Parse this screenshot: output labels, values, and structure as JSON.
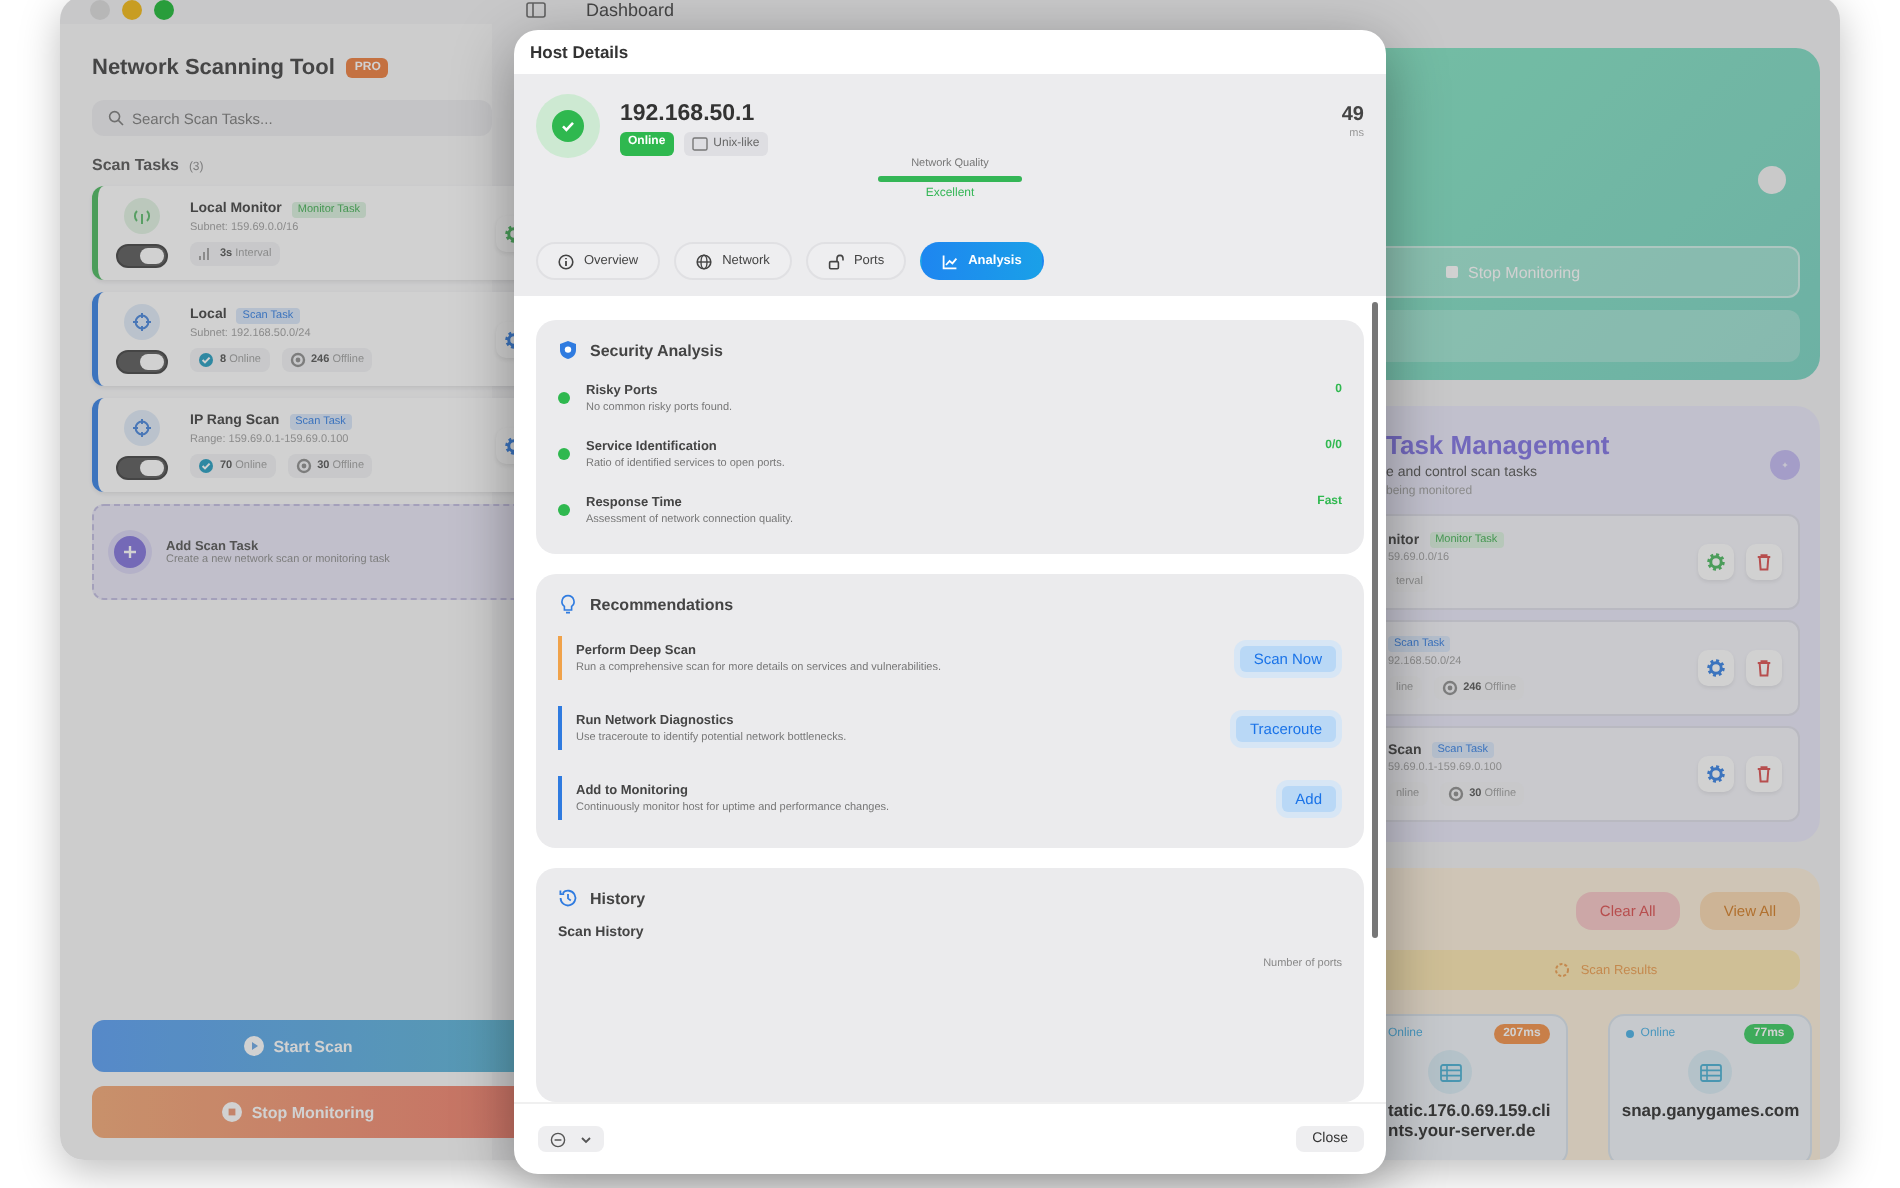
{
  "window": {
    "title": "Dashboard"
  },
  "sidebar": {
    "app_name": "Network Scanning Tool",
    "badge": "PRO",
    "search": {
      "placeholder": "Search Scan Tasks..."
    },
    "section_title": "Scan Tasks",
    "count": "(3)",
    "tasks": [
      {
        "kind": "monitor",
        "name": "Local Monitor",
        "tag": "Monitor Task",
        "detail": "Subnet: 159.69.0.0/16",
        "on": true,
        "stats": [
          {
            "kind": "interval",
            "value": "3s",
            "label": "Interval"
          }
        ]
      },
      {
        "kind": "scan",
        "name": "Local",
        "tag": "Scan Task",
        "detail": "Subnet: 192.168.50.0/24",
        "on": true,
        "stats": [
          {
            "kind": "online",
            "value": "8",
            "label": "Online"
          },
          {
            "kind": "offline",
            "value": "246",
            "label": "Offline"
          }
        ]
      },
      {
        "kind": "scan",
        "name": "IP Rang Scan",
        "tag": "Scan Task",
        "detail": "Range: 159.69.0.1-159.69.0.100",
        "on": true,
        "stats": [
          {
            "kind": "online",
            "value": "70",
            "label": "Online"
          },
          {
            "kind": "offline",
            "value": "30",
            "label": "Offline"
          }
        ]
      }
    ],
    "add_task": {
      "title": "Add Scan Task",
      "subtitle": "Create a new network scan or monitoring task"
    },
    "buttons": [
      {
        "kind": "start",
        "label": "Start Scan"
      },
      {
        "kind": "stop",
        "label": "Stop Monitoring"
      }
    ]
  },
  "monitor_card": {
    "stop_button": "Stop Monitoring"
  },
  "task_management": {
    "title": "Task Management",
    "subtitle": "e and control scan tasks",
    "note": "being monitored",
    "tasks": [
      {
        "kind": "monitor",
        "name": "nitor",
        "tag": "Monitor Task",
        "detail": "59.69.0.0/16",
        "stats": [
          {
            "kind": "interval",
            "label": "terval"
          }
        ]
      },
      {
        "kind": "scan",
        "tag": "Scan Task",
        "detail": "92.168.50.0/24",
        "stats": [
          {
            "kind": "online",
            "label": "line"
          },
          {
            "kind": "offline",
            "value": "246",
            "label": "Offline"
          }
        ]
      },
      {
        "kind": "scan",
        "name": "Scan",
        "tag": "Scan Task",
        "detail": "59.69.0.1-159.69.0.100",
        "stats": [
          {
            "kind": "online",
            "label": "nline"
          },
          {
            "kind": "offline",
            "value": "30",
            "label": "Offline"
          }
        ]
      }
    ]
  },
  "results": {
    "buttons": [
      {
        "kind": "clear",
        "label": "Clear All"
      },
      {
        "kind": "view",
        "label": "View All"
      }
    ],
    "banner": "Scan Results",
    "hosts": [
      {
        "status": "Online",
        "latency": "207ms",
        "color": "#c8804a",
        "name_lines": [
          "tatic.176.0.69.159.cli",
          "nts.your-server.de"
        ]
      },
      {
        "status": "Online",
        "latency": "77ms",
        "color": "#3eab5c",
        "name_lines": [
          "snap.ganygames.com"
        ]
      }
    ]
  },
  "modal": {
    "title": "Host Details",
    "host": {
      "ip": "192.168.50.1",
      "online": true,
      "status": "Online",
      "os": "Unix-like",
      "latency": "49",
      "latency_unit": "ms"
    },
    "quality": {
      "label": "Network Quality",
      "level": 1,
      "rating": "Excellent"
    },
    "tabs": [
      {
        "label": "Overview",
        "selected": false
      },
      {
        "label": "Network",
        "selected": false
      },
      {
        "label": "Ports",
        "selected": false
      },
      {
        "label": "Analysis",
        "selected": true
      }
    ],
    "security": {
      "title": "Security Analysis",
      "items": [
        {
          "title": "Risky Ports",
          "description": "No common risky ports found.",
          "value": "0"
        },
        {
          "title": "Service Identification",
          "description": "Ratio of identified services to open ports.",
          "value": "0/0"
        },
        {
          "title": "Response Time",
          "description": "Assessment of network connection quality.",
          "value": "Fast"
        }
      ]
    },
    "recommendations": {
      "title": "Recommendations",
      "items": [
        {
          "title": "Perform Deep Scan",
          "description": "Run a comprehensive scan for more details on services and vulnerabilities.",
          "action": "Scan Now",
          "color": "#f0a24a"
        },
        {
          "title": "Run Network Diagnostics",
          "description": "Use traceroute to identify potential network bottlenecks.",
          "action": "Traceroute",
          "color": "#2f7be0"
        },
        {
          "title": "Add to Monitoring",
          "description": "Continuously monitor host for uptime and performance changes.",
          "action": "Add",
          "color": "#2f7be0"
        }
      ]
    },
    "history": {
      "title": "History",
      "subtitle": "Scan History",
      "axis_label": "Number of ports"
    },
    "footer": {
      "close": "Close"
    }
  }
}
